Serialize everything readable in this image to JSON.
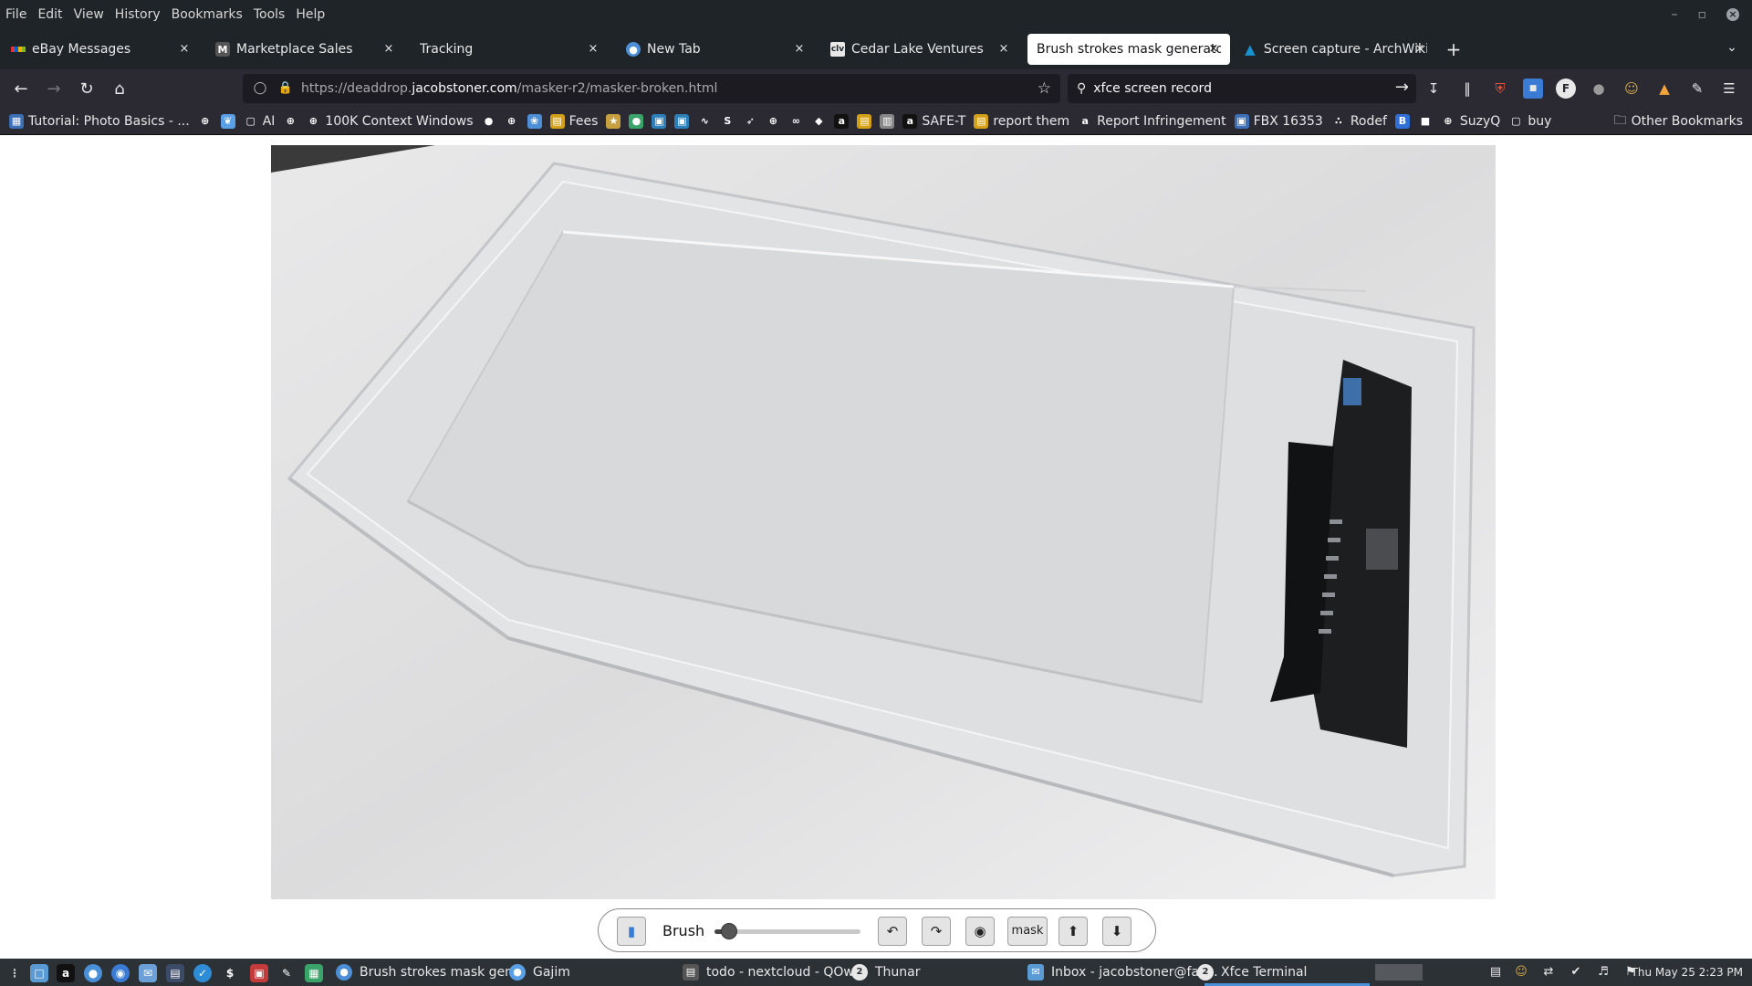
{
  "menubar": {
    "items": [
      "File",
      "Edit",
      "View",
      "History",
      "Bookmarks",
      "Tools",
      "Help"
    ]
  },
  "tabs": [
    {
      "label": "eBay Messages",
      "favicon": "ebay-icon"
    },
    {
      "label": "Marketplace Sales",
      "favicon": "marketplace-icon"
    },
    {
      "label": "Tracking",
      "favicon": ""
    },
    {
      "label": "New Tab",
      "favicon": "firefox-icon"
    },
    {
      "label": "Cedar Lake Ventures",
      "favicon": "clv-icon"
    },
    {
      "label": "Brush strokes mask generator",
      "active": true
    },
    {
      "label": "Screen capture - ArchWiki",
      "favicon": "arch-icon"
    }
  ],
  "urlbar": {
    "url_prefix": "https://deaddrop.",
    "url_host": "jacobstoner.com",
    "url_path": "/masker-r2/masker-broken.html"
  },
  "search": {
    "value": "xfce screen record"
  },
  "bookmarks": {
    "items": [
      {
        "label": "Tutorial: Photo Basics - ...",
        "icon": "tutorial-icon",
        "color": "#3b6fb6"
      },
      {
        "label": "",
        "icon": "globe-icon",
        "color": "#2b2a33"
      },
      {
        "label": "",
        "icon": "bird-icon",
        "color": "#5aa0e6"
      },
      {
        "label": "AI",
        "icon": "folder-icon",
        "color": "#2b2a33"
      },
      {
        "label": "",
        "icon": "globe-icon",
        "color": "#2b2a33"
      },
      {
        "label": "100K Context Windows",
        "icon": "globe-icon",
        "color": "#2b2a33"
      },
      {
        "label": "",
        "icon": "github-icon",
        "color": "#2b2a33"
      },
      {
        "label": "",
        "icon": "globe-icon",
        "color": "#2b2a33"
      },
      {
        "label": "",
        "icon": "openai-icon",
        "color": "#4d8fd6"
      },
      {
        "label": "Fees",
        "icon": "bag-icon",
        "color": "#d4a017"
      },
      {
        "label": "",
        "icon": "star-icon",
        "color": "#c8a040"
      },
      {
        "label": "",
        "icon": "dot-icon",
        "color": "#3aa36a"
      },
      {
        "label": "",
        "icon": "app-icon",
        "color": "#2c7fb8"
      },
      {
        "label": "",
        "icon": "app-icon",
        "color": "#2c7fb8"
      },
      {
        "label": "",
        "icon": "wave-icon",
        "color": "#2b2a33"
      },
      {
        "label": "",
        "icon": "s-icon",
        "color": "#2b2a33"
      },
      {
        "label": "",
        "icon": "rocket-icon",
        "color": "#2b2a33"
      },
      {
        "label": "",
        "icon": "globe-icon",
        "color": "#2b2a33"
      },
      {
        "label": "",
        "icon": "link-icon",
        "color": "#2b2a33"
      },
      {
        "label": "",
        "icon": "diamond-icon",
        "color": "#2b2a33"
      },
      {
        "label": "",
        "icon": "amazon-icon",
        "color": "#111111"
      },
      {
        "label": "",
        "icon": "bag-icon",
        "color": "#d4a017"
      },
      {
        "label": "",
        "icon": "archive-icon",
        "color": "#888888"
      },
      {
        "label": "SAFE-T",
        "icon": "amazon-icon",
        "color": "#111111"
      },
      {
        "label": "report them",
        "icon": "bag-icon",
        "color": "#d4a017"
      },
      {
        "label": "Report Infringement",
        "icon": "amazon-icon",
        "color": "#2b2a33"
      },
      {
        "label": "FBX 16353",
        "icon": "fbx-icon",
        "color": "#3b6fb6"
      },
      {
        "label": "Rodef",
        "icon": "rodef-icon",
        "color": "#2b2a33"
      },
      {
        "label": "",
        "icon": "b-icon",
        "color": "#2f6fd6"
      },
      {
        "label": "",
        "icon": "box-icon",
        "color": "#2b2a33"
      },
      {
        "label": "SuzyQ",
        "icon": "globe-icon",
        "color": "#2b2a33"
      },
      {
        "label": "buy",
        "icon": "folder-icon",
        "color": "#2b2a33"
      }
    ],
    "other": "Other Bookmarks"
  },
  "controls": {
    "brush_label": "Brush",
    "brush_size_fraction": 0.1,
    "mask_label": "mask",
    "undo_icon": "undo-icon",
    "redo_icon": "redo-icon",
    "view_icon": "eye-icon",
    "upload_icon": "upload-icon",
    "download_icon": "download-icon",
    "open_icon": "folder-open-icon"
  },
  "taskbar": {
    "windows": [
      {
        "label": "Brush strokes mask gen...",
        "icon": "firefox-icon"
      },
      {
        "label": "Gajim",
        "icon": "gajim-icon"
      },
      {
        "label": "todo - nextcloud - QOw...",
        "icon": "qownnotes-icon"
      },
      {
        "label": "Thunar",
        "icon": "thunar-icon",
        "badge": "2"
      },
      {
        "label": "Inbox - jacobstoner@fas...",
        "icon": "mail-icon"
      },
      {
        "label": "Xfce Terminal",
        "icon": "terminal-icon",
        "badge": "2"
      }
    ],
    "clock": "Thu May 25  2:23 PM"
  },
  "colors": {
    "accent": "#4a90d9",
    "chrome_dark": "#1f2428",
    "toolbar": "#2b2a33"
  }
}
